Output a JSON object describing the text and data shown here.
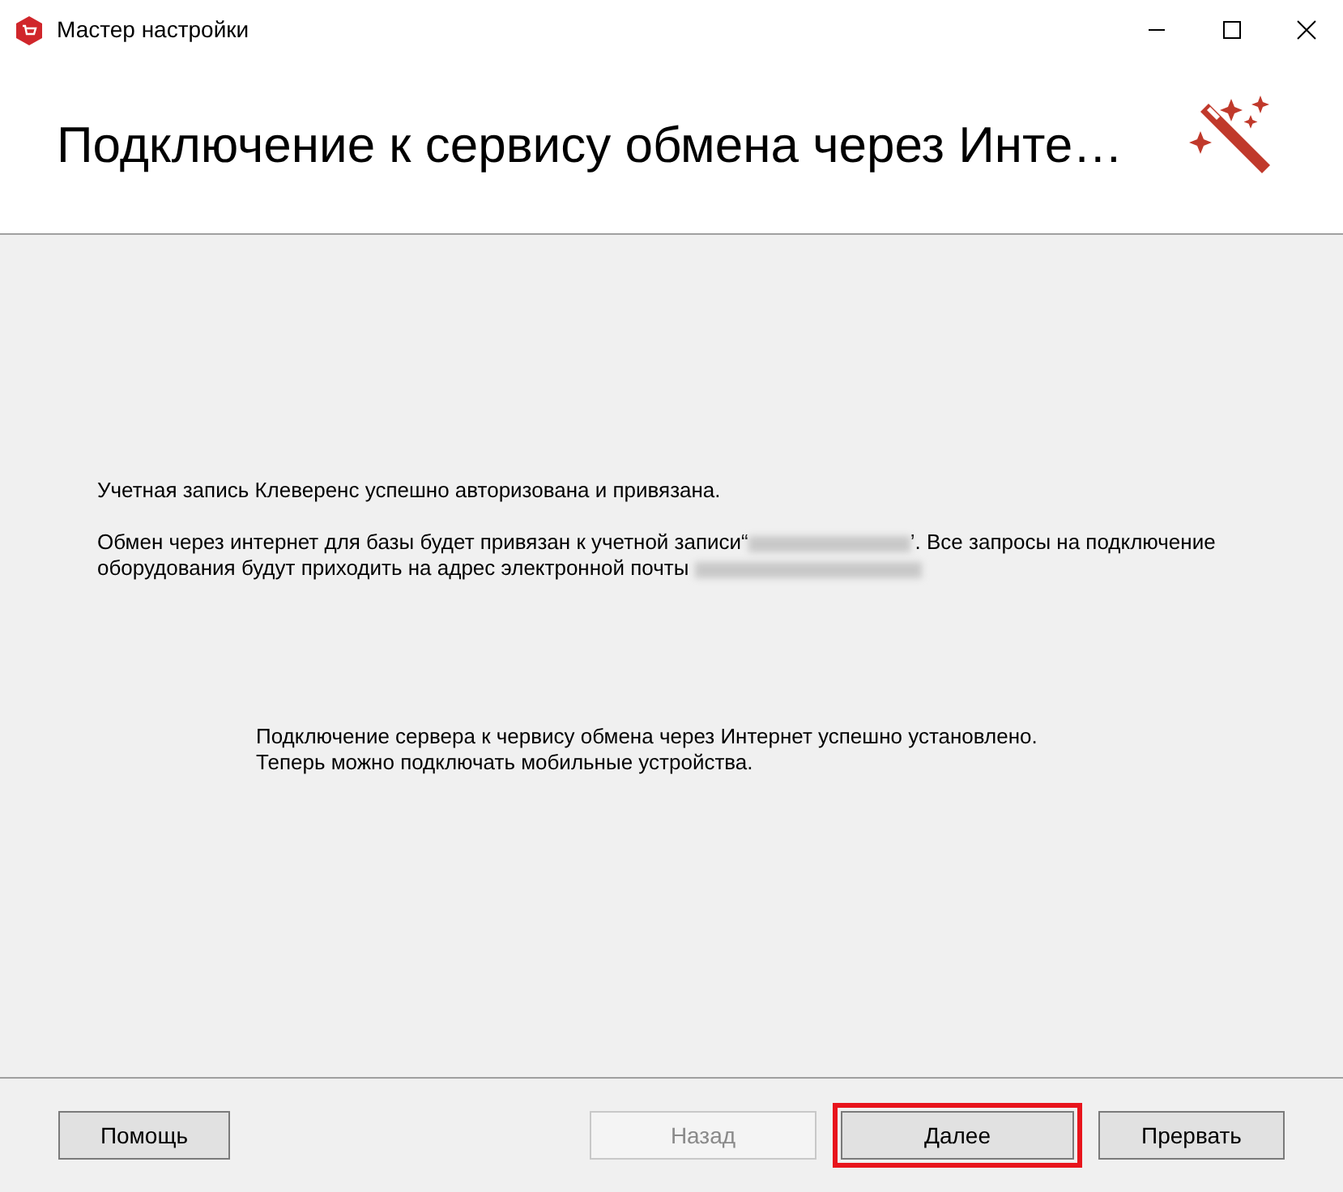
{
  "window": {
    "title": "Мастер настройки"
  },
  "header": {
    "title": "Подключение к сервису обмена через Инте…"
  },
  "body": {
    "status": "Учетная запись Клеверенс успешно авторизована и привязана.",
    "binding_before": "Обмен через интернет для базы будет привязан к учетной записи“",
    "binding_after": "’. Все запросы на подключение",
    "email_label": "оборудования будут приходить на адрес электронной почты",
    "result_lines": [
      "Подключение сервера к червису обмена через Интернет успешно установлено.",
      "Теперь можно подключать мобильные устройства."
    ]
  },
  "buttons": [
    {
      "label": "Помощь",
      "kind": "help",
      "disabled": false,
      "highlighted": false
    },
    {
      "label": "Назад",
      "kind": "nav",
      "disabled": true,
      "highlighted": false
    },
    {
      "label": "Далее",
      "kind": "nav",
      "disabled": false,
      "highlighted": true
    },
    {
      "label": "Прервать",
      "kind": "nav",
      "disabled": false,
      "highlighted": false
    }
  ]
}
